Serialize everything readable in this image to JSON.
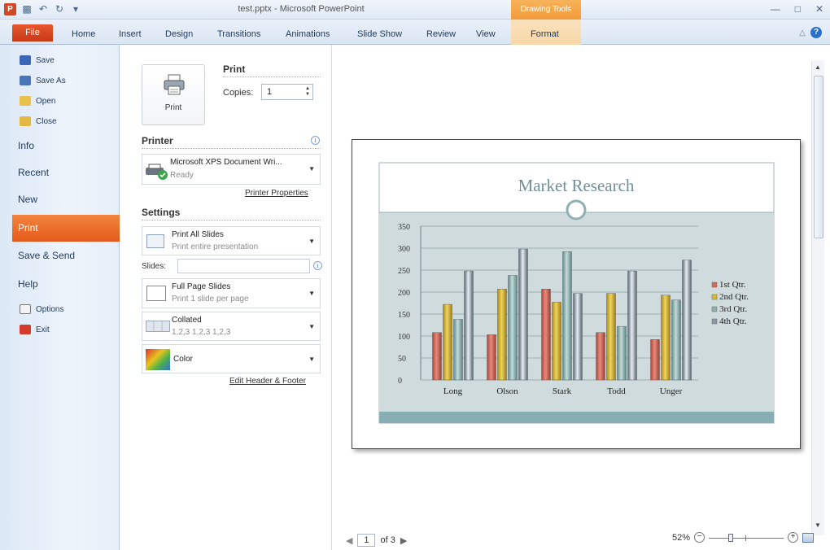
{
  "window": {
    "title": "test.pptx - Microsoft PowerPoint",
    "app_icon_letter": "P",
    "contextual_group": "Drawing Tools"
  },
  "ribbon": {
    "file_label": "File",
    "tabs": [
      "Home",
      "Insert",
      "Design",
      "Transitions",
      "Animations",
      "Slide Show",
      "Review",
      "View",
      "Format"
    ]
  },
  "backstage": {
    "commands": [
      "Save",
      "Save As",
      "Open",
      "Close"
    ],
    "tabs": [
      "Info",
      "Recent",
      "New",
      "Print",
      "Save & Send",
      "Help"
    ],
    "bottom_commands": [
      "Options",
      "Exit"
    ],
    "selected": "Print"
  },
  "print": {
    "heading": "Print",
    "button_label": "Print",
    "copies_label": "Copies:",
    "copies_value": "1"
  },
  "printer": {
    "heading": "Printer",
    "name": "Microsoft XPS Document Wri...",
    "status": "Ready",
    "properties_link": "Printer Properties"
  },
  "settings": {
    "heading": "Settings",
    "slides_option_title": "Print All Slides",
    "slides_option_sub": "Print entire presentation",
    "slides_label": "Slides:",
    "layout_title": "Full Page Slides",
    "layout_sub": "Print 1 slide per page",
    "collate_title": "Collated",
    "collate_sub": "1,2,3   1,2,3   1,2,3",
    "color_title": "Color",
    "header_footer_link": "Edit Header & Footer"
  },
  "preview": {
    "page_current": "1",
    "page_of": "of 3",
    "zoom": "52%"
  },
  "chart_data": {
    "type": "bar",
    "title": "Market Research",
    "categories": [
      "Long",
      "Olson",
      "Stark",
      "Todd",
      "Unger"
    ],
    "series": [
      {
        "name": "1st Qtr.",
        "values": [
          108,
          103,
          207,
          108,
          92
        ],
        "color": "#d66a5b"
      },
      {
        "name": "2nd Qtr.",
        "values": [
          172,
          207,
          177,
          197,
          193
        ],
        "color": "#d9b836"
      },
      {
        "name": "3rd Qtr.",
        "values": [
          138,
          238,
          292,
          122,
          182
        ],
        "color": "#8fb1b1"
      },
      {
        "name": "4th Qtr.",
        "values": [
          248,
          298,
          197,
          248,
          273
        ],
        "color": "#8a9ba8"
      }
    ],
    "yticks": [
      "350",
      "300",
      "250",
      "200",
      "150",
      "100",
      "50",
      "0"
    ],
    "ylim": [
      0,
      350
    ],
    "grid": true,
    "legend_position": "right"
  }
}
